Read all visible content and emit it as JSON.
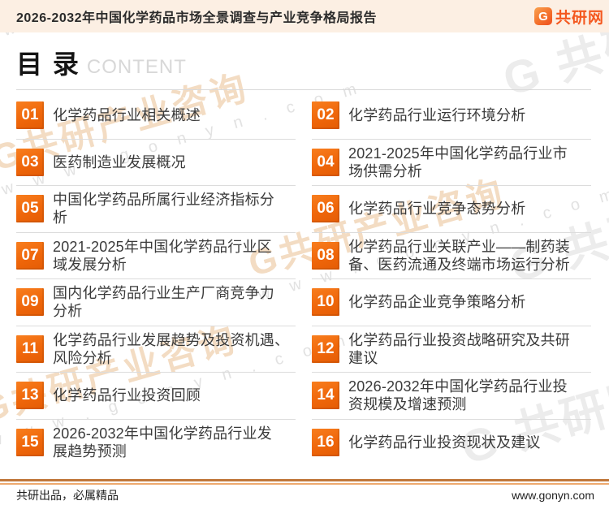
{
  "header": {
    "title": "2026-2032年中国化学药品市场全景调查与产业竞争格局报告",
    "logo_letter": "G",
    "brand": "共研网"
  },
  "toc": {
    "title": "目 录",
    "subtitle": "CONTENT",
    "left_items": [
      {
        "num": "01",
        "label": "化学药品行业相关概述"
      },
      {
        "num": "03",
        "label": "医药制造业发展概况"
      },
      {
        "num": "05",
        "label": "中国化学药品所属行业经济指标分\n析"
      },
      {
        "num": "07",
        "label": "2021-2025年中国化学药品行业区\n域发展分析"
      },
      {
        "num": "09",
        "label": "国内化学药品行业生产厂商竞争力\n分析"
      },
      {
        "num": "11",
        "label": "化学药品行业发展趋势及投资机遇、\n风险分析"
      },
      {
        "num": "13",
        "label": "化学药品行业投资回顾"
      },
      {
        "num": "15",
        "label": "2026-2032年中国化学药品行业发\n展趋势预测"
      }
    ],
    "right_items": [
      {
        "num": "02",
        "label": "化学药品行业运行环境分析"
      },
      {
        "num": "04",
        "label": "2021-2025年中国化学药品行业市\n场供需分析"
      },
      {
        "num": "06",
        "label": "化学药品行业竞争态势分析"
      },
      {
        "num": "08",
        "label": "化学药品行业关联产业——制药装\n备、医药流通及终端市场运行分析"
      },
      {
        "num": "10",
        "label": "化学药品企业竞争策略分析"
      },
      {
        "num": "12",
        "label": "化学药品行业投资战略研究及共研\n建议"
      },
      {
        "num": "14",
        "label": "2026-2032年中国化学药品行业投\n资规模及增速预测"
      },
      {
        "num": "16",
        "label": "化学药品行业投资现状及建议"
      }
    ]
  },
  "footer": {
    "left": "共研出品，必属精品",
    "right": "www.gonyn.com"
  },
  "watermark": {
    "brand_large": "G共研产业咨询",
    "site": "w w w . g o n y n . c o m",
    "logo_text": "G 共研网"
  },
  "colors": {
    "accent_orange": "#ef660a",
    "header_bg": "#fcefe3",
    "logo_orange": "#f4581f",
    "divider_gray": "#dcdcdc",
    "footer_line_dark": "#c0783c",
    "footer_line_light": "#eda96e",
    "watermark_tan": "#f3dcc3",
    "watermark_gray": "#e9e9e9"
  }
}
